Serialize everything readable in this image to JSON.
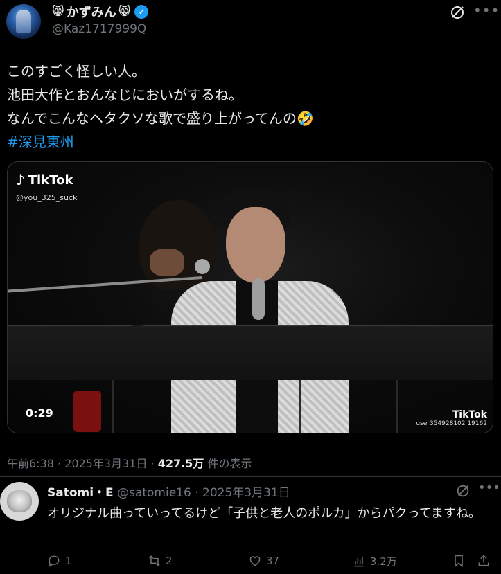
{
  "post": {
    "author": {
      "display_name": "かずみん",
      "emoji_left": "😸",
      "emoji_right": "😸",
      "verified_mark": "✓",
      "handle": "@Kaz1717999Q",
      "avatar_icon": "avatar-image"
    },
    "text_lines": [
      "このすごく怪しい人。",
      "池田大作とおんなじにおいがするね。",
      "なんでこんなヘタクソな歌で盛り上がってんの🤣"
    ],
    "hashtag": "#深見東州",
    "media": {
      "watermark_brand": "TikTok",
      "watermark_user": "@you_325_suck",
      "duration": "0:29",
      "corner_brand": "TikTok",
      "corner_user": "user354928102 19162"
    },
    "meta": {
      "time": "午前6:38",
      "sep1": " · ",
      "date": "2025年3月31日",
      "sep2": " · ",
      "views": "427.5万",
      "views_suffix": " 件の表示"
    }
  },
  "reply": {
    "name": "Satomi・E",
    "handle": "@satomie16",
    "sep": " · ",
    "date": "2025年3月31日",
    "text": "オリジナル曲っていってるけど「子供と老人のポルカ」からパクってますね。",
    "actions": {
      "reply_count": "1",
      "repost_count": "2",
      "like_count": "37",
      "views_count": "3.2万"
    }
  },
  "colors": {
    "background": "#000000",
    "text": "#e7e9ea",
    "muted": "#71767b",
    "accent": "#1d9bf0",
    "divider": "#2f3336"
  },
  "icons": [
    "grok-icon",
    "more-icon",
    "verified-badge-icon",
    "reply-icon",
    "repost-icon",
    "like-icon",
    "views-icon",
    "bookmark-icon",
    "share-icon"
  ]
}
